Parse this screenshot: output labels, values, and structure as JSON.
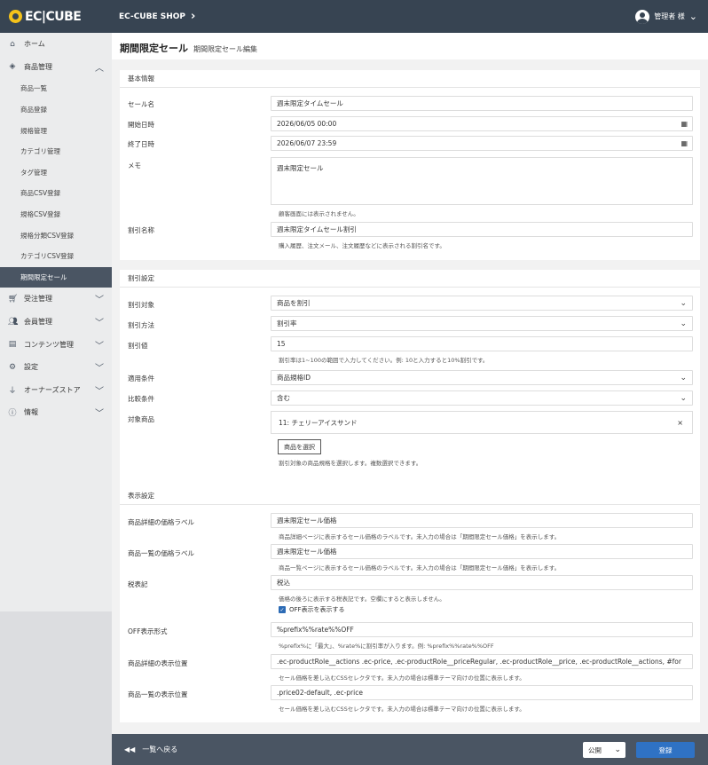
{
  "header": {
    "logo_text": "EC|CUBE",
    "shop_name": "EC-CUBE SHOP",
    "user_name": "管理者 様"
  },
  "sidebar": {
    "items": [
      {
        "label": "ホーム",
        "icon": "home-icon"
      },
      {
        "label": "商品管理",
        "icon": "product-icon"
      },
      {
        "label": "受注管理",
        "icon": "cart-icon"
      },
      {
        "label": "会員管理",
        "icon": "users-icon"
      },
      {
        "label": "コンテンツ管理",
        "icon": "document-icon"
      },
      {
        "label": "設定",
        "icon": "gear-icon"
      },
      {
        "label": "オーナーズストア",
        "icon": "plug-icon"
      },
      {
        "label": "情報",
        "icon": "info-icon"
      }
    ],
    "sub_items": [
      "商品一覧",
      "商品登録",
      "規格管理",
      "カテゴリ管理",
      "タグ管理",
      "商品CSV登録",
      "規格CSV登録",
      "規格分類CSV登録",
      "カテゴリCSV登録",
      "期間限定セール"
    ]
  },
  "page": {
    "title": "期間限定セール",
    "subtitle": "期間限定セール編集"
  },
  "basic": {
    "header": "基本情報",
    "sale_name_label": "セール名",
    "sale_name": "週末限定タイムセール",
    "start_label": "開始日時",
    "start": "2026/06/05 00:00",
    "end_label": "終了日時",
    "end": "2026/06/07 23:59",
    "memo_label": "メモ",
    "memo": "週末限定セール",
    "memo_help": "顧客画面には表示されません。",
    "discount_name_label": "割引名称",
    "discount_name": "週末限定タイムセール割引",
    "discount_name_help": "購入履歴、注文メール、注文履歴などに表示される割引名です。"
  },
  "discount": {
    "header": "割引設定",
    "target_label": "割引対象",
    "target": "商品を割引",
    "method_label": "割引方法",
    "method": "割引率",
    "value_label": "割引値",
    "value": "15",
    "value_help": "割引率は1~100の範囲で入力してください。例: 10と入力すると10%割引です。",
    "condition_label": "適用条件",
    "condition": "商品規格ID",
    "compare_label": "比較条件",
    "compare": "含む",
    "products_label": "対象商品",
    "product_chip": "11: チェリーアイスサンド",
    "remove": "×",
    "select_button": "商品を選択",
    "products_help": "割引対象の商品規格を選択します。複数選択できます。"
  },
  "display": {
    "header": "表示設定",
    "detail_label_label": "商品詳細の価格ラベル",
    "detail_label": "週末限定セール価格",
    "detail_label_help": "商品詳細ページに表示するセール価格のラベルです。未入力の場合は「期間限定セール価格」を表示します。",
    "list_label_label": "商品一覧の価格ラベル",
    "list_label": "週末限定セール価格",
    "list_label_help": "商品一覧ページに表示するセール価格のラベルです。未入力の場合は「期間限定セール価格」を表示します。",
    "tax_label": "税表記",
    "tax": "税込",
    "tax_help": "価格の後ろに表示する税表記です。空欄にすると表示しません。",
    "off_check": "OFF表示を表示する",
    "off_format_label": "OFF表示形式",
    "off_format": "%prefix%%rate%%OFF",
    "off_format_help": "%prefix%に「最大」、%rate%に割引率が入ります。例: %prefix%%rate%%OFF",
    "detail_pos_label": "商品詳細の表示位置",
    "detail_pos": ".ec-productRole__actions .ec-price, .ec-productRole__priceRegular, .ec-productRole__price, .ec-productRole__actions, #for",
    "detail_pos_help": "セール価格を差し込むCSSセレクタです。未入力の場合は標準テーマ向けの位置に表示します。",
    "list_pos_label": "商品一覧の表示位置",
    "list_pos": ".price02-default, .ec-price",
    "list_pos_help": "セール価格を差し込むCSSセレクタです。未入力の場合は標準テーマ向けの位置に表示します。"
  },
  "footer": {
    "back": "一覧へ戻る",
    "status": "公開",
    "save": "登録"
  }
}
